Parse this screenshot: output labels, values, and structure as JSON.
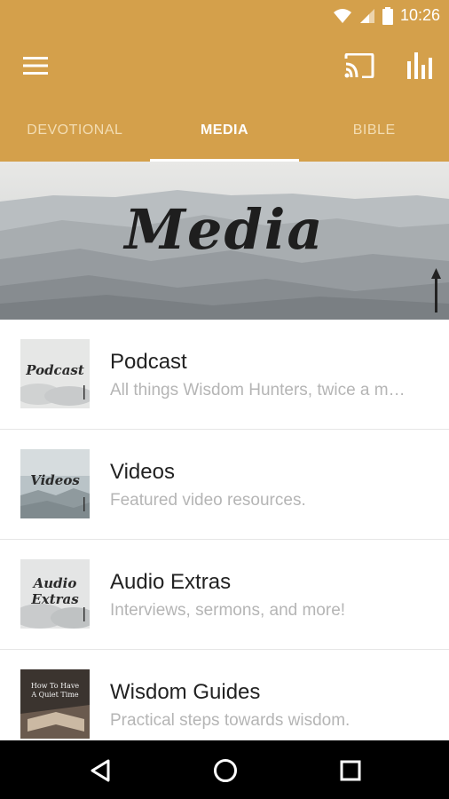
{
  "status": {
    "time": "10:26",
    "icons": [
      "wifi-icon",
      "signal-icon",
      "battery-icon"
    ]
  },
  "appbar": {
    "icons": [
      "menu-icon",
      "cast-icon",
      "stats-icon"
    ]
  },
  "tabs": [
    {
      "label": "DEVOTIONAL",
      "active": false
    },
    {
      "label": "MEDIA",
      "active": true
    },
    {
      "label": "BIBLE",
      "active": false
    }
  ],
  "banner": {
    "title": "Media"
  },
  "items": [
    {
      "title": "Podcast",
      "subtitle": "All things Wisdom Hunters, twice a m…",
      "thumb_text": "Podcast"
    },
    {
      "title": "Videos",
      "subtitle": "Featured video resources.",
      "thumb_text": "Videos"
    },
    {
      "title": "Audio Extras",
      "subtitle": "Interviews, sermons, and more!",
      "thumb_text": "Audio Extras"
    },
    {
      "title": "Wisdom Guides",
      "subtitle": "Practical steps towards wisdom.",
      "thumb_text": "How To Have A Quiet Time"
    }
  ],
  "navbar": {
    "icons": [
      "back-icon",
      "home-icon",
      "recents-icon"
    ]
  },
  "colors": {
    "accent": "#d4a04b",
    "tab_inactive": "#f3ddb3",
    "subtitle": "#b5b5b5"
  }
}
